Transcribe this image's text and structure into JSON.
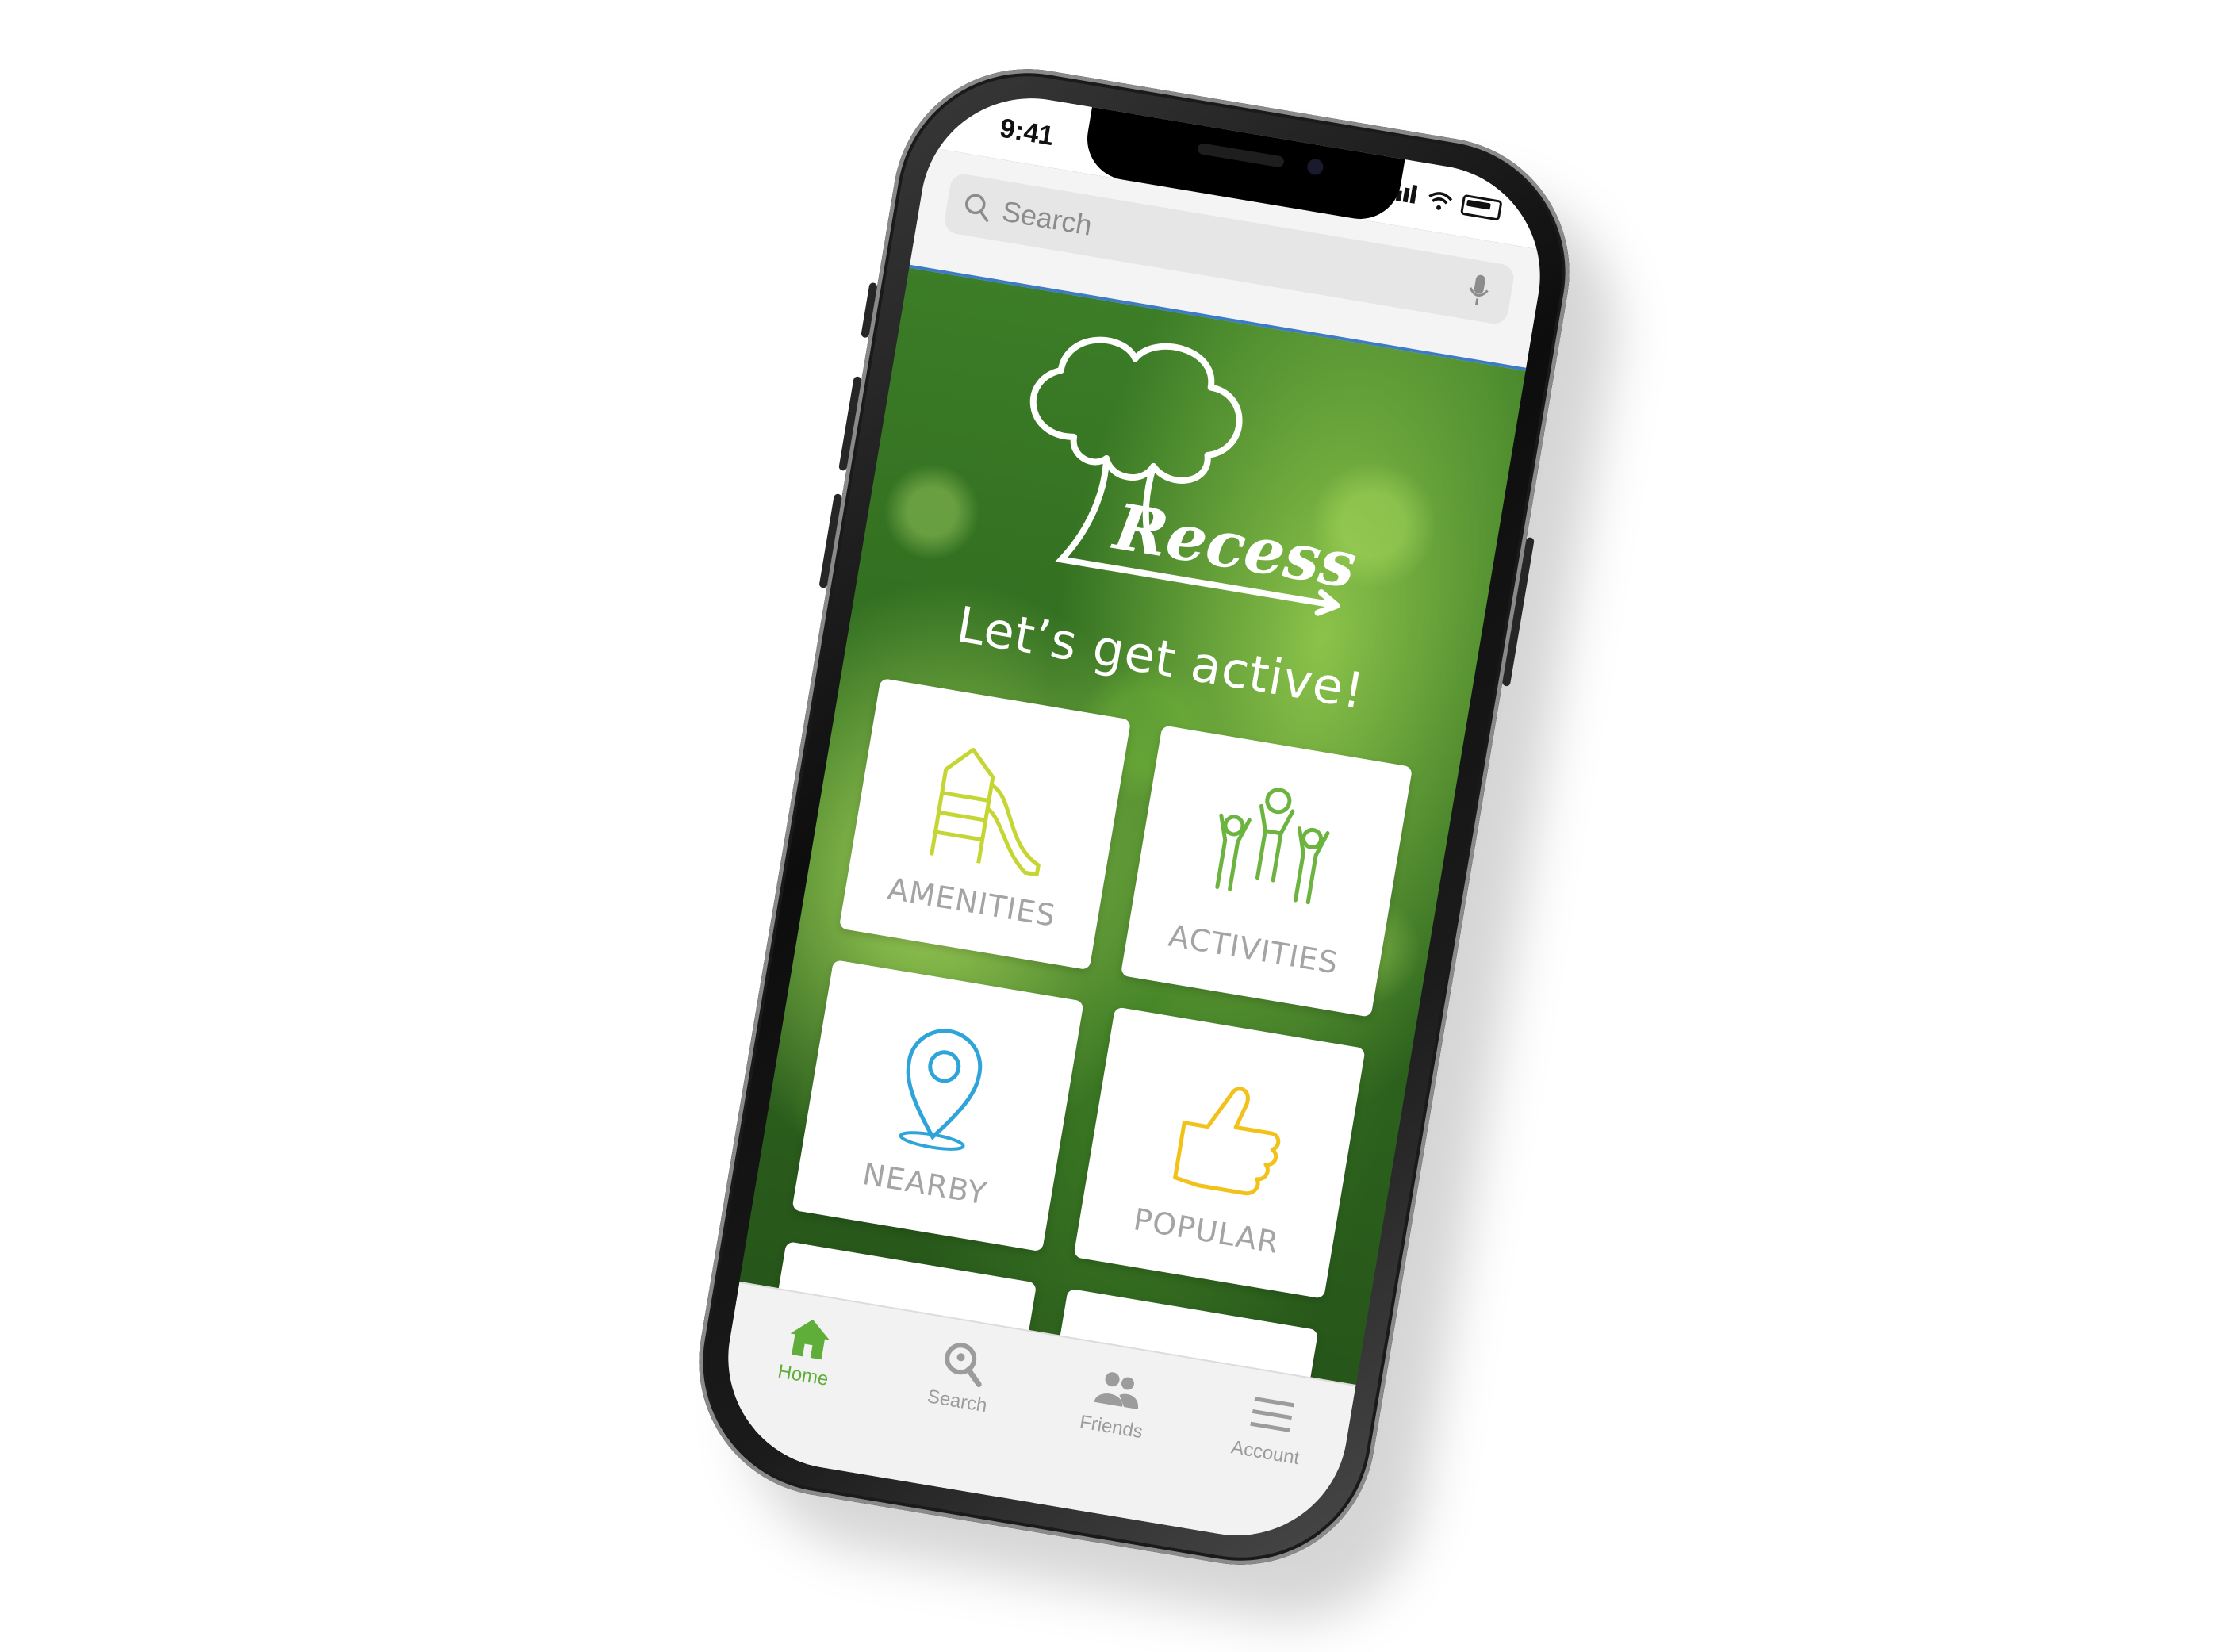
{
  "status": {
    "time": "9:41"
  },
  "search": {
    "placeholder": "Search"
  },
  "hero": {
    "brand": "Recess",
    "tagline": "Let’s get active!"
  },
  "tiles": [
    {
      "label": "AMENITIES",
      "icon": "playground-slide-icon",
      "color": "#c5d634"
    },
    {
      "label": "ACTIVITIES",
      "icon": "people-cheering-icon",
      "color": "#6cb33f"
    },
    {
      "label": "NEARBY",
      "icon": "location-pin-icon",
      "color": "#2fa4d8"
    },
    {
      "label": "POPULAR",
      "icon": "thumbs-up-icon",
      "color": "#f2c21b"
    }
  ],
  "tabbar": {
    "items": [
      {
        "label": "Home",
        "icon": "home-icon",
        "active": true
      },
      {
        "label": "Search",
        "icon": "search-magnifier-icon",
        "active": false
      },
      {
        "label": "Friends",
        "icon": "friends-icon",
        "active": false
      },
      {
        "label": "Account",
        "icon": "menu-icon",
        "active": false
      }
    ]
  },
  "colors": {
    "accent": "#5fae3a",
    "header_border": "#3d7bc4",
    "tile_label": "#a4a4a4"
  }
}
